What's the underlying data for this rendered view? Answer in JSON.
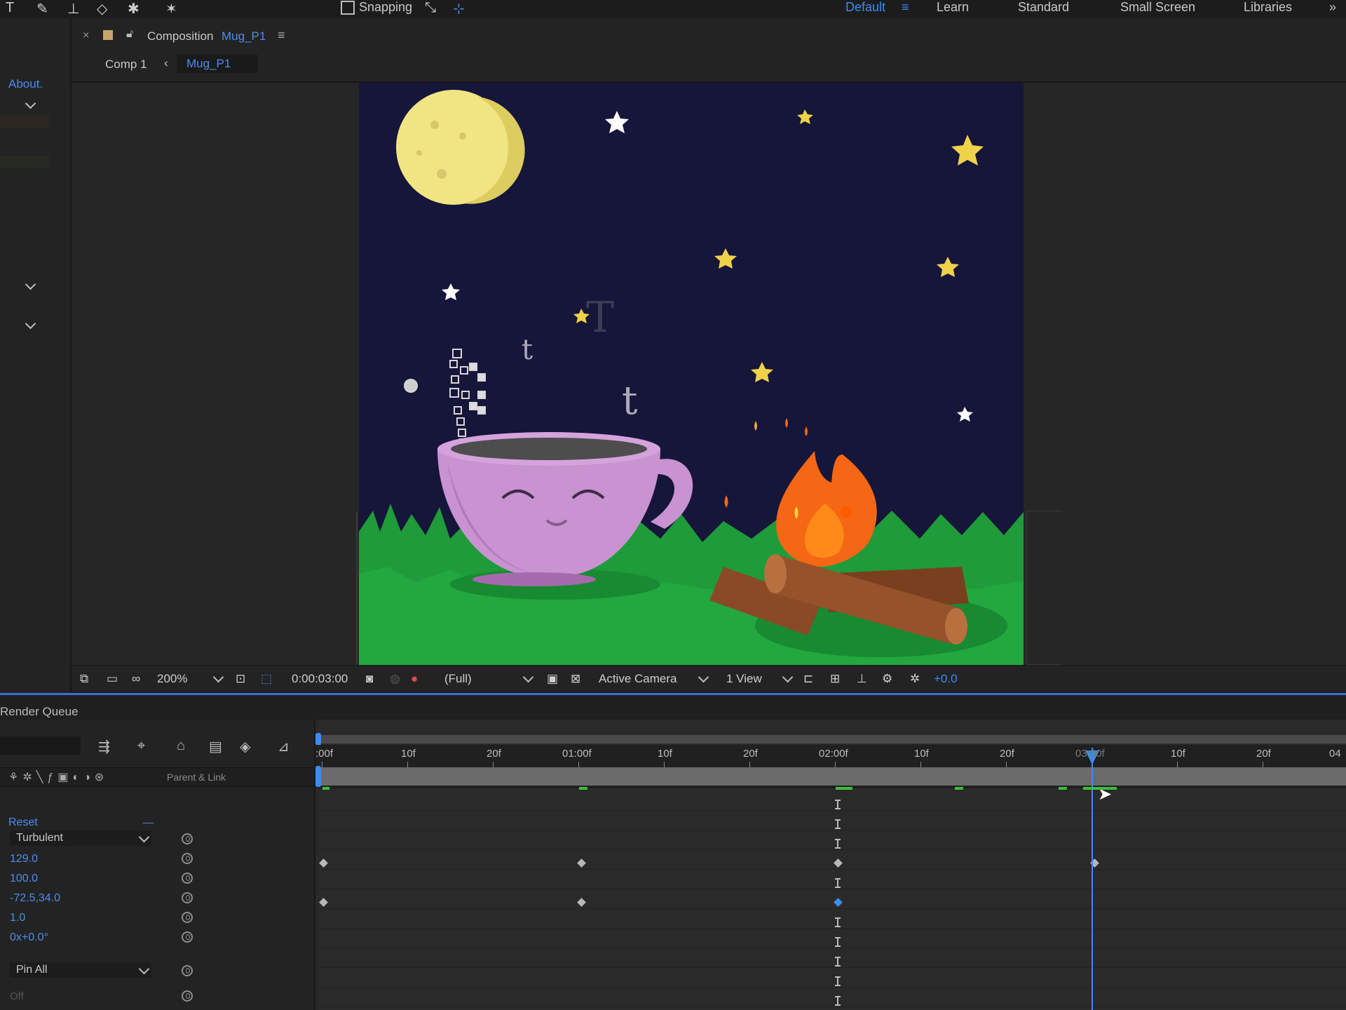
{
  "toolbar": {
    "snapping_label": "Snapping",
    "workspaces": [
      "Default",
      "Learn",
      "Standard",
      "Small Screen",
      "Libraries"
    ],
    "active_workspace": "Default"
  },
  "left_panel": {
    "about_label": "About."
  },
  "composition": {
    "tab_prefix": "Composition",
    "tab_name": "Mug_P1",
    "breadcrumb_parent": "Comp 1",
    "breadcrumb_current": "Mug_P1"
  },
  "viewer_controls": {
    "zoom": "200%",
    "timecode": "0:00:03:00",
    "resolution": "(Full)",
    "camera": "Active Camera",
    "views": "1 View",
    "exposure": "+0.0"
  },
  "timeline": {
    "panel_title": "Render Queue",
    "column_parent": "Parent & Link",
    "ruler_labels": [
      ":00f",
      "10f",
      "20f",
      "01:00f",
      "10f",
      "20f",
      "02:00f",
      "10f",
      "20f",
      "03:00f",
      "10f",
      "20f",
      "04"
    ],
    "properties": [
      {
        "label": "Reset",
        "type": "link"
      },
      {
        "label": "Turbulent",
        "type": "dropdown"
      },
      {
        "label": "129.0",
        "type": "value"
      },
      {
        "label": "100.0",
        "type": "value"
      },
      {
        "label": "-72.5,34.0",
        "type": "value"
      },
      {
        "label": "1.0",
        "type": "value"
      },
      {
        "label": "0x+0.0°",
        "type": "value"
      },
      {
        "label": "Pin All",
        "type": "dropdown"
      },
      {
        "label": "Off",
        "type": "dim"
      }
    ]
  },
  "colors": {
    "accent_blue": "#3b8cf0",
    "keyframe_green": "#3bbf3b",
    "sky": "#16153a",
    "grass": "#1f9b3a",
    "mug": "#c992d0"
  }
}
